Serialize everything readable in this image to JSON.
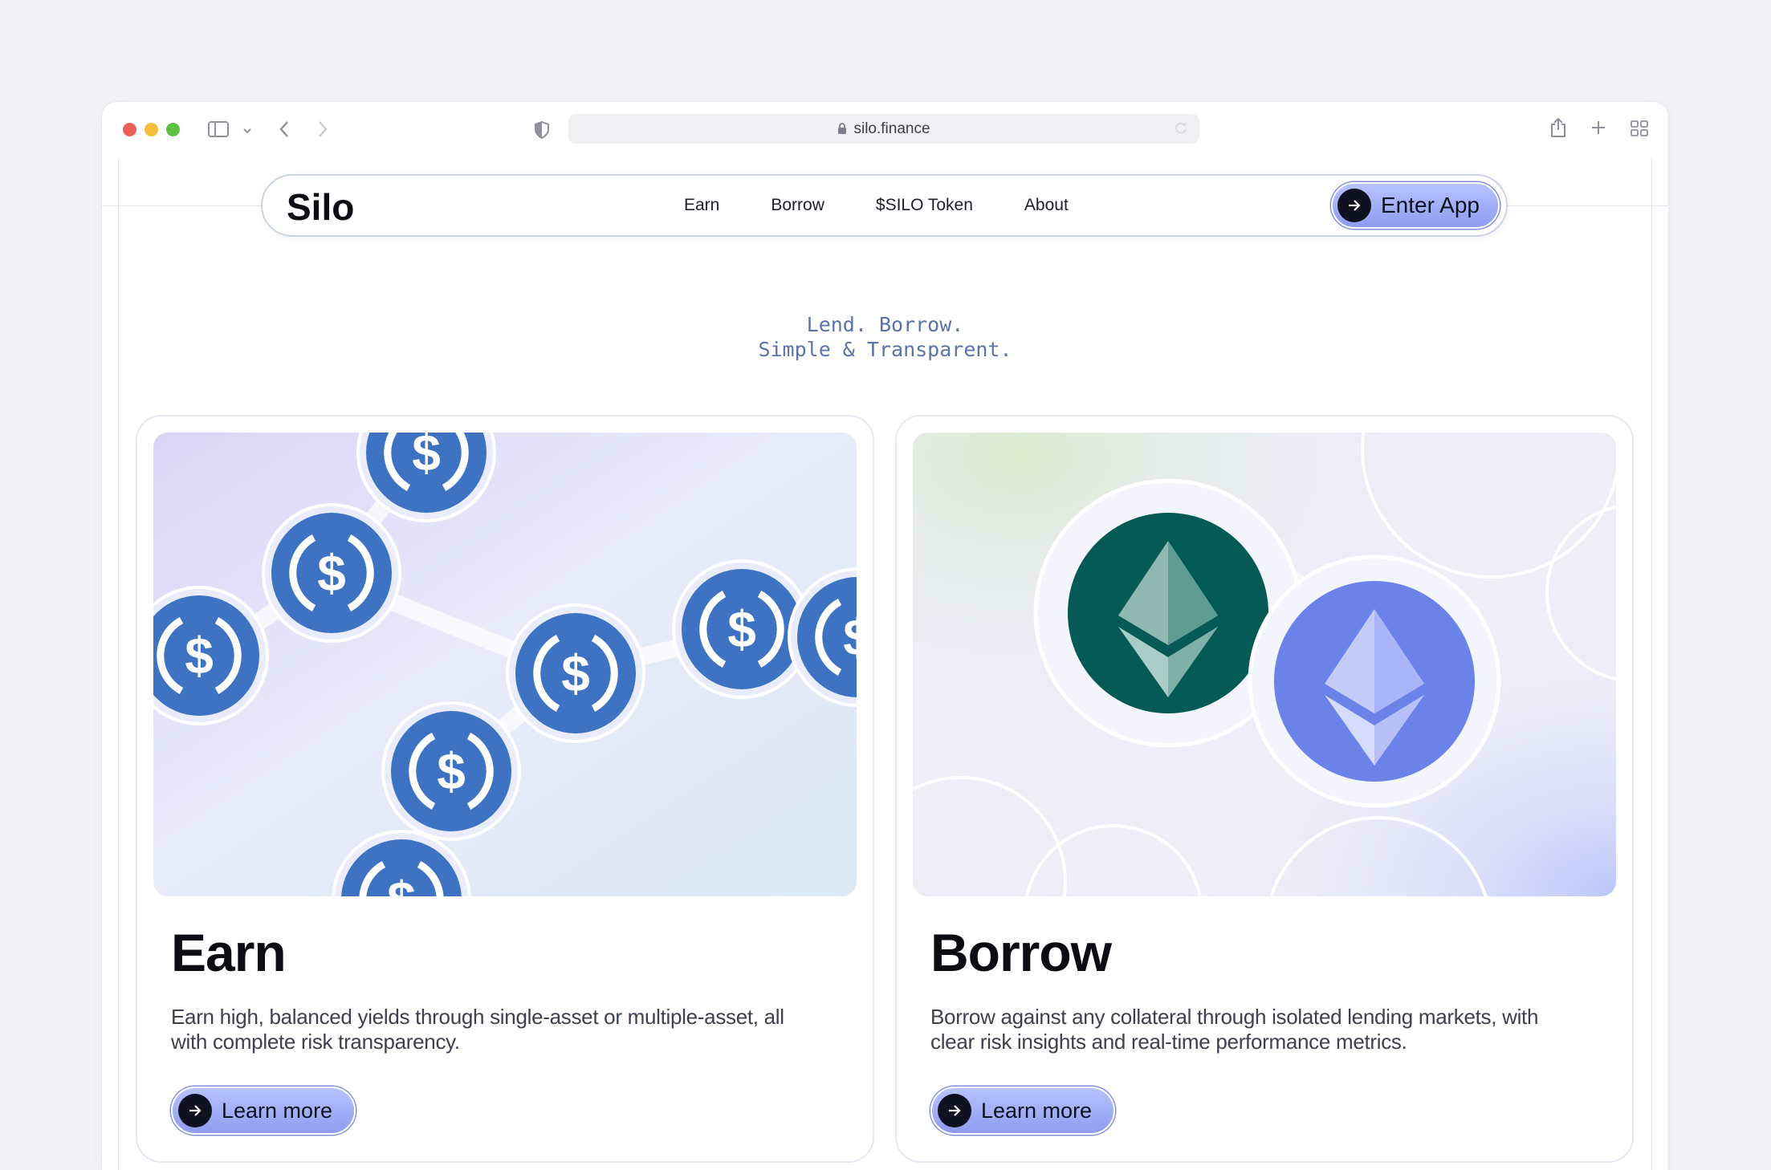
{
  "browser": {
    "url": "silo.finance"
  },
  "navbar": {
    "logo_text": "Silo",
    "links": [
      "Earn",
      "Borrow",
      "$SILO Token",
      "About"
    ],
    "cta_label": "Enter App"
  },
  "hero": {
    "tagline_line1": "Lend. Borrow.",
    "tagline_line2": "Simple & Transparent."
  },
  "cards": [
    {
      "title": "Earn",
      "description": "Earn high, balanced yields through single-asset or multiple-asset, all with complete risk transparency.",
      "button_label": "Learn more",
      "illustration": "usdc-coins-icon"
    },
    {
      "title": "Borrow",
      "description": "Borrow against any collateral through isolated lending markets, with clear risk insights and real-time performance metrics.",
      "button_label": "Learn more",
      "illustration": "ethereum-coins-icon"
    }
  ],
  "colors": {
    "accent": "#9aa6f5",
    "usdc": "#3e73c4",
    "eth_dark": "#065a55",
    "eth_light": "#6b82e8",
    "tagline": "#5a73a8"
  }
}
